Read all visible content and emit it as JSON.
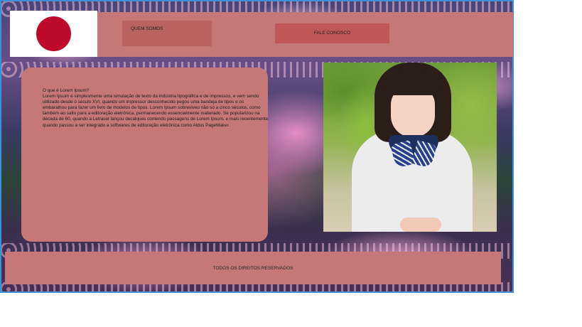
{
  "nav": {
    "about_label": "QUEM SOMOS",
    "contact_label": "FALE CONOSCO"
  },
  "content": {
    "title": "O que é Lorem Ipsum?",
    "body": "Lorem Ipsum é simplesmente uma simulação de texto da indústria tipográfica e de impressos, e vem sendo utilizado desde o século XVI, quando um impressor desconhecido pegou uma bandeja de tipos e os embaralhou para fazer um livro de modelos de tipos. Lorem Ipsum sobreviveu não só a cinco séculos, como também ao salto para a editoração eletrônica, permanecendo essencialmente inalterado. Se popularizou na década de 60, quando a Letraset lançou decalques contendo passagens de Lorem Ipsum, e mais recentemente quando passou a ser integrado a softwares de editoração eletrônica como Aldus PageMaker."
  },
  "footer": {
    "text": "TODOS OS DIREITOS RESERVADOS"
  },
  "colors": {
    "panel": "#c67878",
    "flag_disc": "#bc0a2c",
    "frame_border": "#3d8fd6"
  }
}
